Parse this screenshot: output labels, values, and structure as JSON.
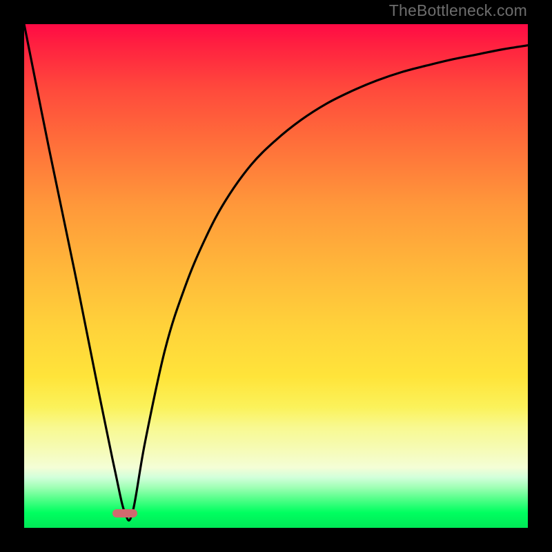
{
  "watermark": "TheBottleneck.com",
  "colors": {
    "background_top": "#ff0a45",
    "background_bottom": "#00e756",
    "curve": "#000000",
    "marker": "#cf6a6f",
    "frame": "#000000"
  },
  "marker": {
    "x_frac": 0.2,
    "y_frac": 0.971
  },
  "chart_data": {
    "type": "line",
    "title": "",
    "xlabel": "",
    "ylabel": "",
    "xlim": [
      0,
      1
    ],
    "ylim": [
      0,
      1
    ],
    "x": [
      0.0,
      0.05,
      0.1,
      0.15,
      0.18,
      0.2,
      0.215,
      0.24,
      0.28,
      0.32,
      0.36,
      0.4,
      0.45,
      0.5,
      0.55,
      0.6,
      0.65,
      0.7,
      0.75,
      0.8,
      0.85,
      0.9,
      0.95,
      1.0
    ],
    "y": [
      1.0,
      0.75,
      0.51,
      0.26,
      0.115,
      0.03,
      0.03,
      0.17,
      0.355,
      0.48,
      0.575,
      0.65,
      0.72,
      0.77,
      0.81,
      0.842,
      0.867,
      0.888,
      0.905,
      0.918,
      0.93,
      0.94,
      0.95,
      0.958
    ],
    "annotations": [
      {
        "text": "TheBottleneck.com",
        "position": "top-right"
      }
    ],
    "marker": {
      "x": 0.2,
      "y": 0.029,
      "shape": "pill",
      "color": "#cf6a6f"
    },
    "notes": "x and y are normalized fractions of the plot area (0–1). y measured from bottom (0) to top (1). Curve is a V that bottoms near x≈0.2 then rises with diminishing slope; background gradient encodes value from red (top) to green (bottom)."
  }
}
